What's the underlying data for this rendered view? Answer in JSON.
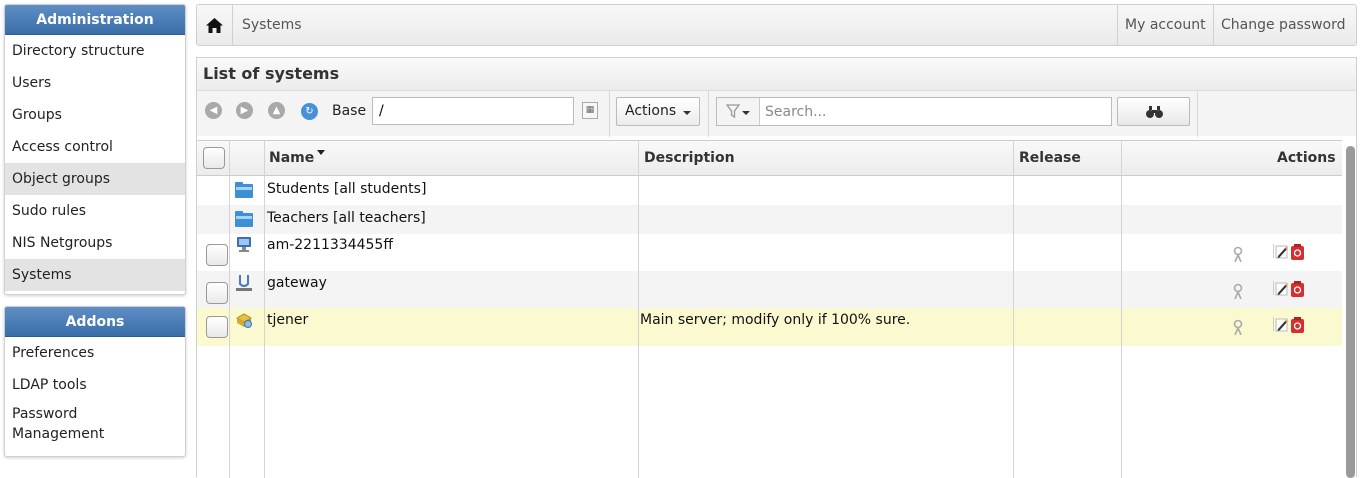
{
  "sidebar": {
    "admin_title": "Administration",
    "admin_items": [
      {
        "label": "Directory structure"
      },
      {
        "label": "Users"
      },
      {
        "label": "Groups"
      },
      {
        "label": "Access control"
      },
      {
        "label": "Object groups"
      },
      {
        "label": "Sudo rules"
      },
      {
        "label": "NIS Netgroups"
      },
      {
        "label": "Systems"
      }
    ],
    "addons_title": "Addons",
    "addons_items": [
      {
        "label": "Preferences"
      },
      {
        "label": "LDAP tools"
      },
      {
        "label": "Password Management"
      }
    ]
  },
  "topbar": {
    "breadcrumb": "Systems",
    "my_account": "My account",
    "change_password": "Change password"
  },
  "panel": {
    "title": "List of systems",
    "toolbar": {
      "base_label": "Base",
      "base_value": "/",
      "actions_label": "Actions",
      "search_placeholder": "Search..."
    },
    "table": {
      "headers": {
        "name": "Name",
        "description": "Description",
        "release": "Release",
        "actions": "Actions"
      },
      "sorted_column": "Name",
      "rows": [
        {
          "icon": "folder-icon",
          "name": "Students [all students]",
          "description": "",
          "release": "",
          "has_checkbox": false,
          "has_actions": false
        },
        {
          "icon": "folder-icon",
          "name": "Teachers [all teachers]",
          "description": "",
          "release": "",
          "has_checkbox": false,
          "has_actions": false
        },
        {
          "icon": "workstation-icon",
          "name": "am-2211334455ff",
          "description": "",
          "release": "",
          "has_checkbox": true,
          "has_actions": true
        },
        {
          "icon": "gateway-icon",
          "name": "gateway",
          "description": "",
          "release": "",
          "has_checkbox": true,
          "has_actions": true
        },
        {
          "icon": "server-icon",
          "name": "tjener",
          "description": "Main server; modify only if 100% sure.",
          "release": "",
          "has_checkbox": true,
          "has_actions": true
        }
      ]
    }
  },
  "colors": {
    "menu_header": "#3a6ea8",
    "highlight_row": "#fbf9d0",
    "alt_row": "#f4f4f4",
    "selected_menu": "#e3e3e3"
  }
}
